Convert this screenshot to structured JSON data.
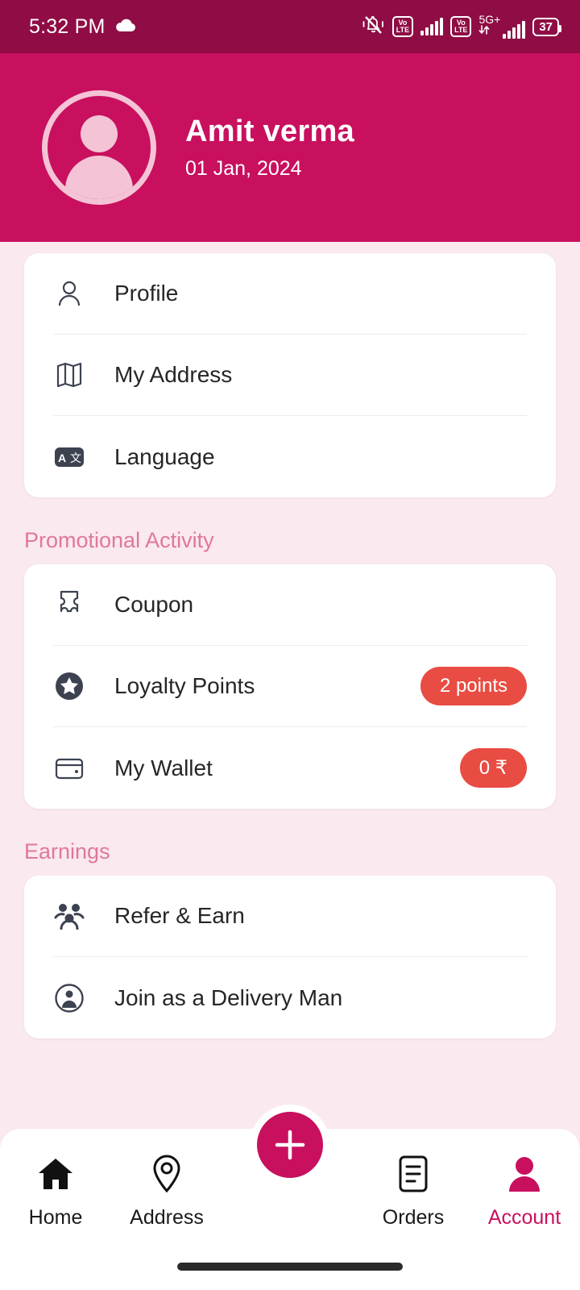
{
  "status_bar": {
    "time": "5:32 PM",
    "weather_icon": "cloud-icon",
    "mute_icon": "bell-muted-icon",
    "volte_top": "Vo",
    "volte_bottom": "LTE",
    "network_label": "5G+",
    "battery_level": "37"
  },
  "header": {
    "avatar_icon": "user-avatar-icon",
    "name": "Amit verma",
    "date": "01 Jan, 2024",
    "background_color": "#C8105E"
  },
  "account_card": {
    "items": [
      {
        "icon": "person-icon",
        "label": "Profile"
      },
      {
        "icon": "map-icon",
        "label": "My Address"
      },
      {
        "icon": "translate-icon",
        "label": "Language"
      }
    ]
  },
  "promotional": {
    "title": "Promotional Activity",
    "items": [
      {
        "icon": "coupon-icon",
        "label": "Coupon",
        "badge": ""
      },
      {
        "icon": "star-icon",
        "label": "Loyalty Points",
        "badge": "2 points"
      },
      {
        "icon": "wallet-icon",
        "label": "My Wallet",
        "badge": "0 ₹"
      }
    ]
  },
  "earnings": {
    "title": "Earnings",
    "items": [
      {
        "icon": "group-icon",
        "label": "Refer & Earn"
      },
      {
        "icon": "delivery-man-icon",
        "label": "Join as a Delivery Man"
      }
    ]
  },
  "bottom_nav": {
    "items": [
      {
        "icon": "home-icon",
        "label": "Home",
        "active": false
      },
      {
        "icon": "location-icon",
        "label": "Address",
        "active": false
      },
      {
        "icon": "plus-icon",
        "label": "",
        "active": false
      },
      {
        "icon": "orders-icon",
        "label": "Orders",
        "active": false
      },
      {
        "icon": "account-icon",
        "label": "Account",
        "active": true
      }
    ],
    "active_color": "#C8105E"
  },
  "colors": {
    "status_bar": "#8F0D44",
    "brand": "#C8105E",
    "page_background": "#FAE9EE",
    "badge": "#E84C42",
    "section_title": "#E0789B"
  }
}
